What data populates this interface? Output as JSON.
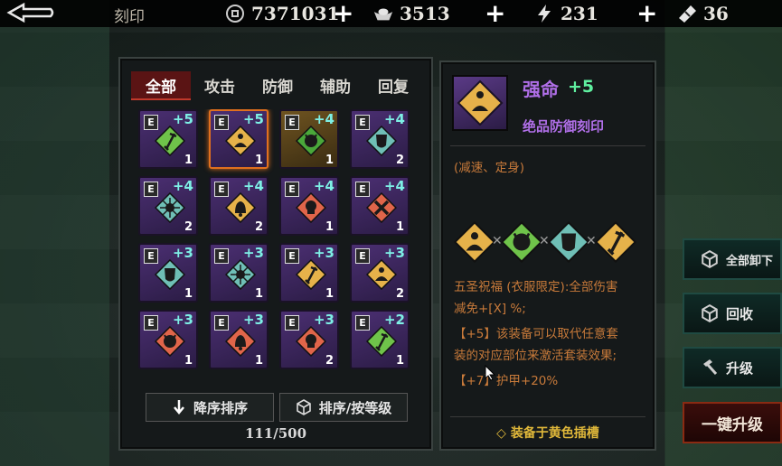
{
  "topbar": {
    "title": "刻印",
    "resources": [
      {
        "icon": "coin-icon",
        "value": "7371031"
      },
      {
        "icon": "silver-ingot-icon",
        "value": "3513"
      },
      {
        "icon": "lightning-icon",
        "value": "231"
      },
      {
        "icon": "ticket-icon",
        "value": "36"
      }
    ],
    "plus_label": "+"
  },
  "tabs": [
    {
      "label": "全部",
      "active": true
    },
    {
      "label": "攻击",
      "active": false
    },
    {
      "label": "防御",
      "active": false
    },
    {
      "label": "辅助",
      "active": false
    },
    {
      "label": "回复",
      "active": false
    }
  ],
  "grid_items": [
    {
      "badge": "E",
      "level": "+5",
      "count": "1",
      "symbol": "sword",
      "color": "#6fc34a",
      "frame": "purple"
    },
    {
      "badge": "E",
      "level": "+5",
      "count": "1",
      "symbol": "meditate",
      "color": "#e6b24a",
      "frame": "purple",
      "selected": true
    },
    {
      "badge": "E",
      "level": "+4",
      "count": "1",
      "symbol": "demon",
      "color": "#4aa83a",
      "frame": "gold"
    },
    {
      "badge": "E",
      "level": "+4",
      "count": "2",
      "symbol": "mask",
      "color": "#6fbfb6",
      "frame": "purple"
    },
    {
      "badge": "E",
      "level": "+4",
      "count": "2",
      "symbol": "burst",
      "color": "#6fbfb6",
      "frame": "purple"
    },
    {
      "badge": "E",
      "level": "+4",
      "count": "2",
      "symbol": "bell",
      "color": "#e6b24a",
      "frame": "purple"
    },
    {
      "badge": "E",
      "level": "+4",
      "count": "1",
      "symbol": "skull",
      "color": "#e0654a",
      "frame": "purple"
    },
    {
      "badge": "E",
      "level": "+4",
      "count": "1",
      "symbol": "cross",
      "color": "#e0654a",
      "frame": "purple"
    },
    {
      "badge": "E",
      "level": "+3",
      "count": "1",
      "symbol": "mask",
      "color": "#6fbfb6",
      "frame": "purple"
    },
    {
      "badge": "E",
      "level": "+3",
      "count": "1",
      "symbol": "burst",
      "color": "#6fbfb6",
      "frame": "purple"
    },
    {
      "badge": "E",
      "level": "+3",
      "count": "1",
      "symbol": "sword",
      "color": "#e6b24a",
      "frame": "purple"
    },
    {
      "badge": "E",
      "level": "+3",
      "count": "2",
      "symbol": "meditate",
      "color": "#e6b24a",
      "frame": "purple"
    },
    {
      "badge": "E",
      "level": "+3",
      "count": "1",
      "symbol": "demon",
      "color": "#e0654a",
      "frame": "purple"
    },
    {
      "badge": "E",
      "level": "+3",
      "count": "1",
      "symbol": "bell",
      "color": "#e0654a",
      "frame": "purple"
    },
    {
      "badge": "E",
      "level": "+3",
      "count": "2",
      "symbol": "skull",
      "color": "#e0654a",
      "frame": "purple"
    },
    {
      "badge": "E",
      "level": "+2",
      "count": "1",
      "symbol": "sword",
      "color": "#6fc34a",
      "frame": "purple"
    }
  ],
  "sort": {
    "desc_label": "降序排序",
    "by_level_label": "排序/按等级"
  },
  "inventory_count": "111/500",
  "detail": {
    "name": "强命",
    "level": "+5",
    "type": "绝品防御刻印",
    "effect_tail": "(减速、定身)",
    "set_icons": [
      {
        "symbol": "meditate",
        "color": "#e6b24a"
      },
      {
        "symbol": "demon",
        "color": "#6fc34a"
      },
      {
        "symbol": "mask",
        "color": "#6fbfb6"
      },
      {
        "symbol": "sword",
        "color": "#e6b24a"
      }
    ],
    "set_bonus_line1": "五圣祝福 (衣服限定):全部伤害",
    "set_bonus_line2": "减免+[X] %;",
    "plus5_line1": "【+5】该装备可以取代任意套",
    "plus5_line2": "装的对应部位来激活套装效果;",
    "plus7_line": "【+7】护甲+20%",
    "equip_note": "◇ 装备于黄色插槽"
  },
  "side_buttons": {
    "unequip_all": "全部卸下",
    "recycle": "回收",
    "upgrade": "升级",
    "one_click_upgrade": "一键升级"
  },
  "colors": {
    "accent_red": "#c0392b",
    "purple_text": "#b06fe8",
    "level_green": "#5ff0a0",
    "desc_orange": "#c87a3a",
    "note_yellow": "#e0b83a"
  }
}
